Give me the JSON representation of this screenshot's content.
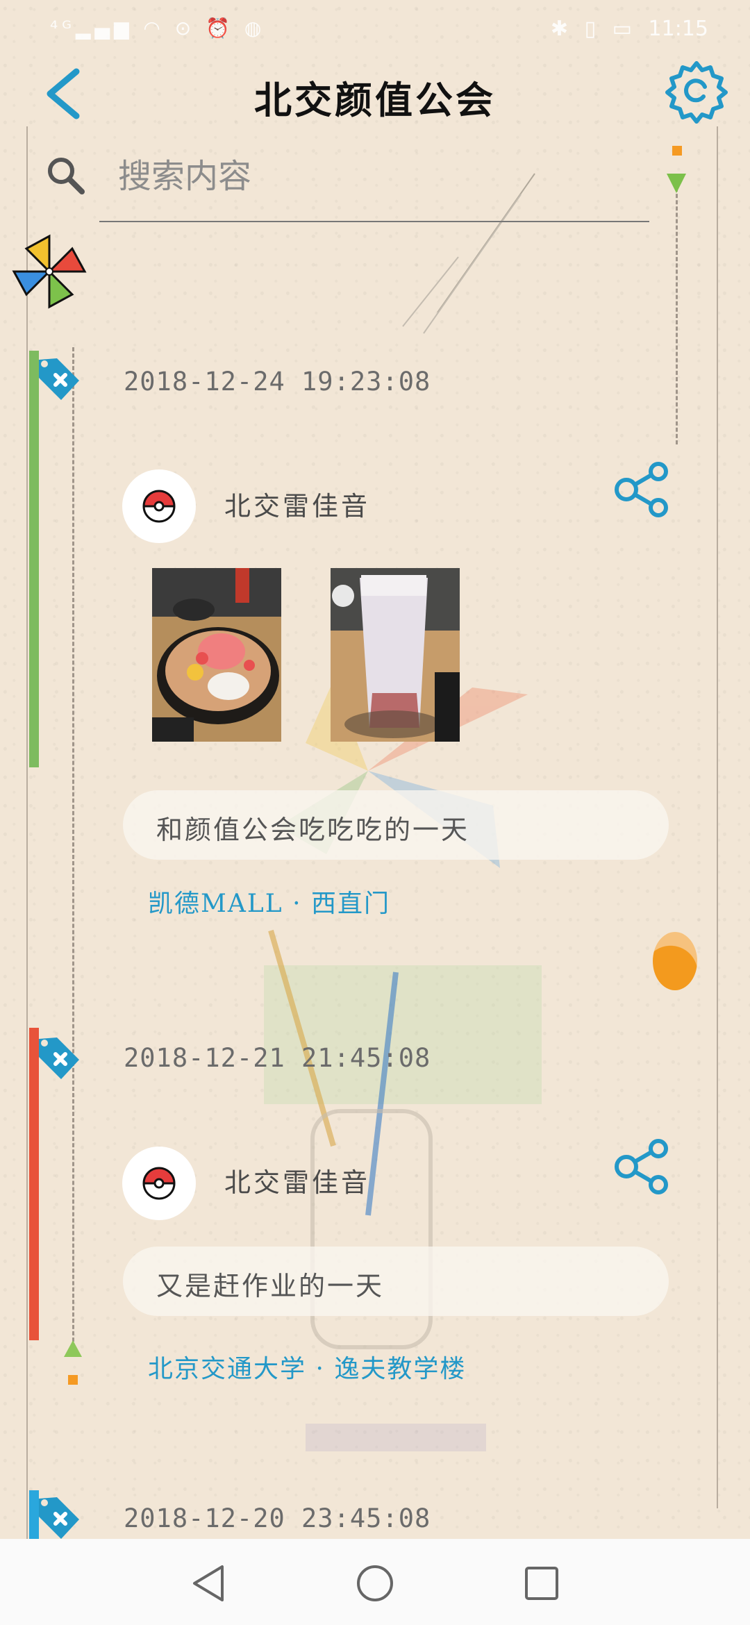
{
  "status_bar": {
    "left_icons": [
      "signal-icon",
      "wifi-icon",
      "eye-icon",
      "alarm-icon",
      "wechat-icon"
    ],
    "time": "11:15"
  },
  "header": {
    "title": "北交颜值公会"
  },
  "search": {
    "placeholder": "搜索内容"
  },
  "colors": {
    "accent": "#2398c8",
    "green_bar": "#7dbb5f",
    "red_bar": "#e8533a",
    "blue_bar": "#2aa7dd"
  },
  "posts": [
    {
      "date": "2018-12-24 19:23:08",
      "username": "北交雷佳音",
      "photos": [
        "dessert-photo",
        "milk-tea-photo"
      ],
      "content": "和颜值公会吃吃吃的一天",
      "location": "凯德MALL · 西直门",
      "bar_color": "#7dbb5f"
    },
    {
      "date": "2018-12-21 21:45:08",
      "username": "北交雷佳音",
      "photos": [],
      "content": "又是赶作业的一天",
      "location": "北京交通大学 · 逸夫教学楼",
      "bar_color": "#e8533a"
    },
    {
      "date": "2018-12-20 23:45:08",
      "bar_color": "#2aa7dd"
    }
  ],
  "nav": {
    "back": "back-triangle-icon",
    "home": "home-circle-icon",
    "recents": "recents-square-icon"
  }
}
